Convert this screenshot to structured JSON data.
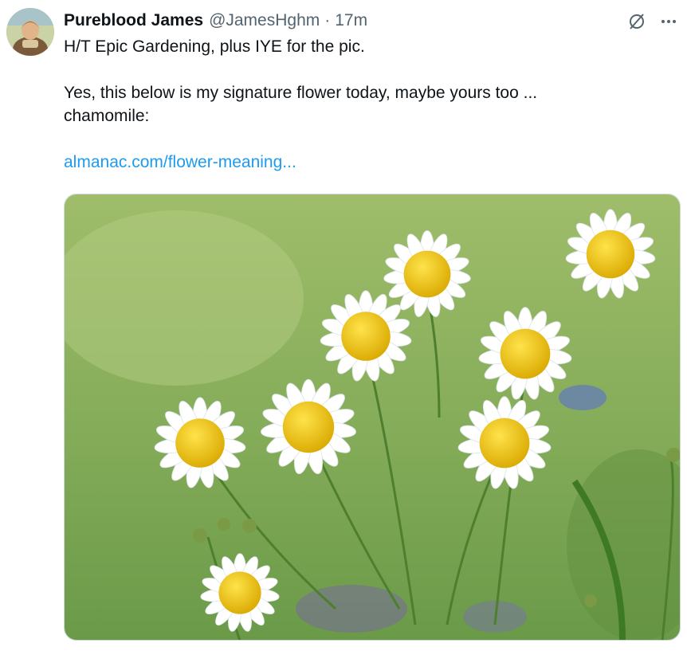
{
  "author": {
    "display_name": "Pureblood James",
    "handle": "@JamesHghm",
    "separator": "·",
    "timestamp": "17m",
    "avatar_icon": "avatar-image"
  },
  "header_icons": [
    "grok-slash-icon",
    "more-icon"
  ],
  "tweet": {
    "line1": "H/T Epic Gardening, plus IYE for the pic.",
    "line2": "Yes, this below is my signature flower today, maybe yours too ...",
    "line3": "chamomile:",
    "link_text": "almanac.com/flower-meaning..."
  },
  "colors": {
    "link": "#1d9bf0",
    "secondary_text": "#536471",
    "primary_text": "#0f1419"
  }
}
